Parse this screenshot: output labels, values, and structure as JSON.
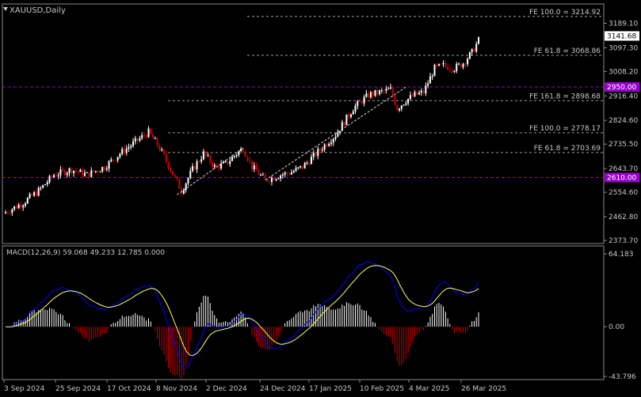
{
  "chart_data": {
    "type": "candlestick",
    "symbol_label": "XAUUSD,Daily",
    "price_axis": {
      "ylim": [
        2373.7,
        3250
      ],
      "ticks": [
        "3189.10",
        "3097.30",
        "3008.20",
        "2916.40",
        "2824.60",
        "2735.50",
        "2643.70",
        "2554.60",
        "2462.80",
        "2373.70"
      ],
      "tick_values": [
        3189.1,
        3097.3,
        3008.2,
        2916.4,
        2824.6,
        2735.5,
        2643.7,
        2554.6,
        2462.8,
        2373.7
      ]
    },
    "current_price": {
      "label": "3141.68",
      "value": 3141.68
    },
    "levels": [
      {
        "label": "2950.00",
        "value": 2950.0,
        "color": "#9900cc"
      },
      {
        "label": "2610.00",
        "value": 2610.0,
        "color": "#9900cc"
      }
    ],
    "fib_lines": [
      {
        "label": "FE 100.0 = 3214.92",
        "value": 3214.92
      },
      {
        "label": "FE 61.8 = 3068.86",
        "value": 3068.86
      },
      {
        "label": "FE 161.8 = 2898.68",
        "value": 2898.68
      },
      {
        "label": "FE 100.0 = 2778.17",
        "value": 2778.17
      },
      {
        "label": "FE 61.8 = 2703.69",
        "value": 2703.69
      }
    ],
    "x_ticks": [
      "3 Sep 2024",
      "25 Sep 2024",
      "17 Oct 2024",
      "8 Nov 2024",
      "2 Dec 2024",
      "24 Dec 2024",
      "17 Jan 2025",
      "10 Feb 2025",
      "4 Mar 2025",
      "26 Mar 2025"
    ],
    "anchors": [
      [
        0,
        2480
      ],
      [
        8,
        2515
      ],
      [
        15,
        2560
      ],
      [
        22,
        2620
      ],
      [
        30,
        2640
      ],
      [
        37,
        2620
      ],
      [
        45,
        2650
      ],
      [
        52,
        2700
      ],
      [
        60,
        2750
      ],
      [
        65,
        2780
      ],
      [
        70,
        2720
      ],
      [
        75,
        2640
      ],
      [
        80,
        2560
      ],
      [
        85,
        2640
      ],
      [
        90,
        2700
      ],
      [
        95,
        2650
      ],
      [
        100,
        2660
      ],
      [
        105,
        2700
      ],
      [
        108,
        2720
      ],
      [
        112,
        2650
      ],
      [
        118,
        2600
      ],
      [
        125,
        2620
      ],
      [
        130,
        2630
      ],
      [
        135,
        2650
      ],
      [
        140,
        2690
      ],
      [
        146,
        2740
      ],
      [
        150,
        2770
      ],
      [
        158,
        2870
      ],
      [
        165,
        2920
      ],
      [
        170,
        2930
      ],
      [
        175,
        2940
      ],
      [
        178,
        2870
      ],
      [
        182,
        2900
      ],
      [
        186,
        2920
      ],
      [
        190,
        2930
      ],
      [
        195,
        3020
      ],
      [
        199,
        3030
      ],
      [
        204,
        3020
      ],
      [
        208,
        3040
      ],
      [
        212,
        3080
      ],
      [
        216,
        3140
      ]
    ],
    "macd": {
      "label": "MACD(12,26,9) 59.068 49.233 12.785 0.000",
      "ylim": [
        -43.796,
        64.183
      ],
      "ticks": [
        "64.183",
        "0.00",
        "-43.796"
      ],
      "tick_values": [
        64.183,
        0,
        -43.796
      ],
      "line_color": "#0000ff",
      "signal_color": "#ffff66",
      "hist_pos_color": "#ffffff",
      "hist_neg_color": "#cc0000"
    },
    "colors": {
      "bull": "#ffffff",
      "bear": "#cc0000",
      "grid": "#6a6a6a",
      "text": "#c8c8c8"
    }
  }
}
